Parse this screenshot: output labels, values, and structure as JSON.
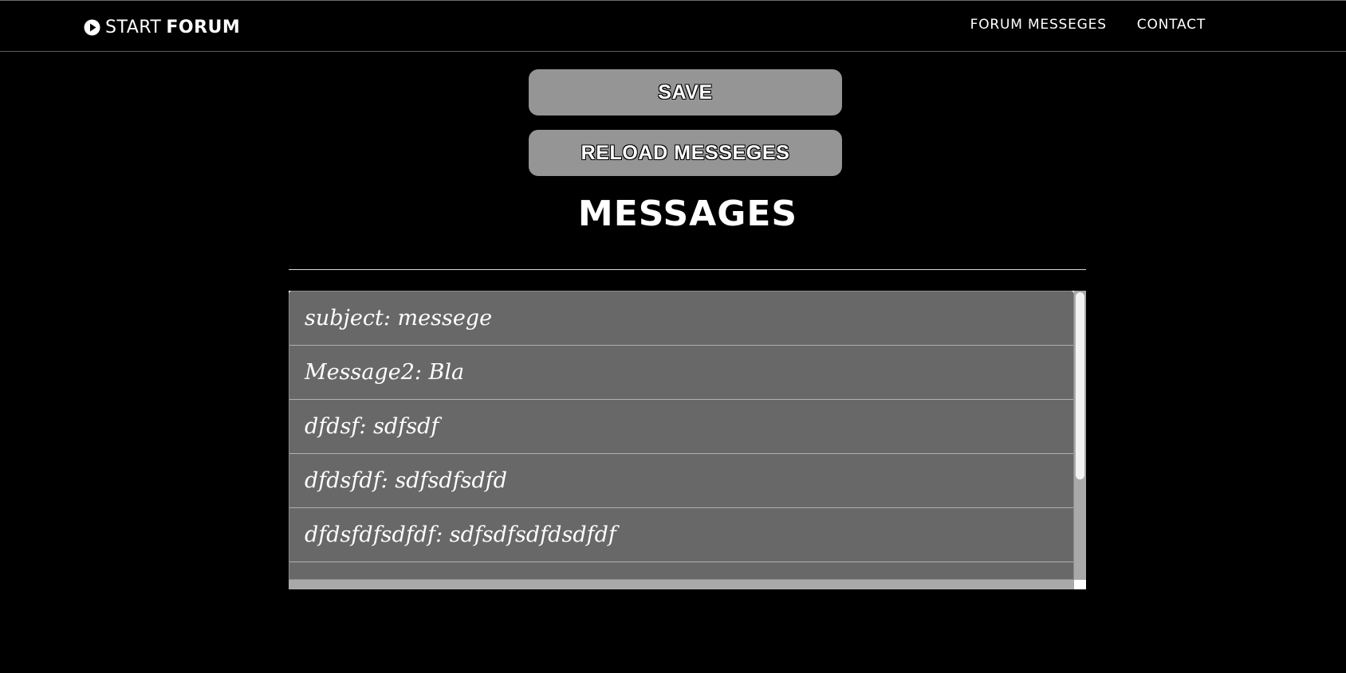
{
  "navbar": {
    "brand_light": "START",
    "brand_bold": "FORUM",
    "links": [
      "FORUM MESSEGES",
      "CONTACT"
    ]
  },
  "actions": {
    "save_label": "SAVE",
    "reload_label": "RELOAD MESSEGES"
  },
  "page_title": "MESSAGES",
  "messages": [
    "subject: messege",
    "Message2: Bla",
    "dfdsf: sdfsdf",
    "dfdsfdf: sdfsdfsdfd",
    "dfdsfdfsdfdf: sdfsdfsdfdsdfdf",
    ""
  ],
  "colors": {
    "background": "#000000",
    "button": "#959595",
    "list_item": "#686868",
    "scrollbar": "#a9a9a9"
  }
}
